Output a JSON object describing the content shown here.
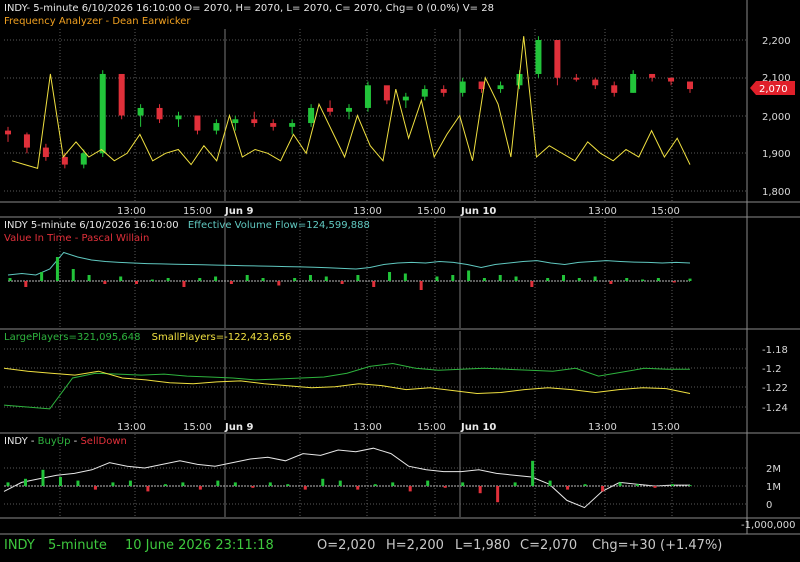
{
  "colors": {
    "background": "#000000",
    "grid": "#5a5a5a",
    "panel_border": "#8a8a8a",
    "axis_text": "#d8d8d8",
    "up": "#22c43a",
    "down": "#e0303a",
    "yellow": "#f0e040",
    "orange": "#f0a020",
    "cyan": "#60c8c0",
    "white": "#e8e8e8",
    "green_line": "#2eb43e",
    "status_green": "#3ec83e",
    "status_gray": "#c8c8c8",
    "last_price_bg": "#e0202a"
  },
  "panel1": {
    "header": "INDY- 5-minute 6/10/2026 16:10:00 O= 2070, H= 2070, L= 2070, C= 2070, Chg= 0 (0.0%) V= 28",
    "indicator": "Frequency Analyzer - Dean Earwicker",
    "last_price": "2,070",
    "y_ticks": [
      "2,200",
      "2,100",
      "2,000",
      "1,900",
      "1,800"
    ]
  },
  "time_axis": {
    "labels": [
      "13:00",
      "15:00",
      "Jun 9",
      "13:00",
      "15:00",
      "Jun 10",
      "13:00",
      "15:00"
    ]
  },
  "panel2": {
    "title_prefix": "INDY 5-minute  6/10/2026 16:10:00",
    "title_flow": "Effective Volume Flow=124,599,888",
    "subtitle": "Value In Time - Pascal Willain"
  },
  "panel3": {
    "large": "LargePlayers=321,095,648",
    "small": "SmallPlayers=-122,423,656",
    "y_ticks": [
      "-1.18",
      "-1.2",
      "-1.22",
      "-1.24"
    ]
  },
  "panel4": {
    "name": "INDY - ",
    "buy": "BuyUp",
    "sep": "-",
    "sell": "SellDown",
    "y_ticks": [
      "2M",
      "1M",
      "0",
      "-1,000,000"
    ]
  },
  "status": {
    "symbol": "INDY",
    "interval": "5-minute",
    "datetime": "10 June 2026 23:11:18",
    "o": "O=2,020",
    "h": "H=2,200",
    "l": "L=1,980",
    "c": "C=2,070",
    "chg": "Chg=+30 (+1.47%)"
  },
  "chart_data": [
    {
      "type": "candlestick",
      "title": "INDY- 5-minute",
      "series": [
        {
          "name": "INDY",
          "ohlc_approx": [
            [
              1960,
              1970,
              1930,
              1950
            ],
            [
              1950,
              1955,
              1900,
              1915
            ],
            [
              1915,
              1925,
              1880,
              1890
            ],
            [
              1890,
              1900,
              1860,
              1870
            ],
            [
              1870,
              1910,
              1860,
              1900
            ],
            [
              1900,
              2120,
              1890,
              2110
            ],
            [
              2110,
              2100,
              1990,
              2000
            ],
            [
              2000,
              2030,
              1970,
              2020
            ],
            [
              2020,
              2030,
              1980,
              1990
            ],
            [
              1990,
              2010,
              1970,
              2000
            ],
            [
              2000,
              1990,
              1950,
              1960
            ],
            [
              1960,
              1990,
              1950,
              1980
            ],
            [
              1980,
              2000,
              1960,
              1990
            ],
            [
              1990,
              2010,
              1970,
              1980
            ],
            [
              1980,
              1990,
              1960,
              1970
            ],
            [
              1970,
              1990,
              1950,
              1980
            ],
            [
              1980,
              2030,
              1970,
              2020
            ],
            [
              2020,
              2040,
              2000,
              2010
            ],
            [
              2010,
              2030,
              1990,
              2020
            ],
            [
              2020,
              2090,
              2010,
              2080
            ],
            [
              2080,
              2070,
              2030,
              2040
            ],
            [
              2040,
              2060,
              2020,
              2050
            ],
            [
              2050,
              2080,
              2040,
              2070
            ],
            [
              2070,
              2080,
              2050,
              2060
            ],
            [
              2060,
              2100,
              2050,
              2090
            ],
            [
              2090,
              2090,
              2060,
              2070
            ],
            [
              2070,
              2090,
              2060,
              2080
            ],
            [
              2080,
              2120,
              2070,
              2110
            ],
            [
              2110,
              2210,
              2100,
              2200
            ],
            [
              2200,
              2110,
              2080,
              2100
            ],
            [
              2100,
              2110,
              2090,
              2095
            ],
            [
              2095,
              2100,
              2070,
              2080
            ],
            [
              2080,
              2090,
              2050,
              2060
            ],
            [
              2060,
              2120,
              2060,
              2110
            ],
            [
              2110,
              2110,
              2090,
              2100
            ],
            [
              2100,
              2100,
              2080,
              2090
            ],
            [
              2090,
              2080,
              2060,
              2070
            ]
          ]
        },
        {
          "name": "Frequency Analyzer - Dean Earwicker",
          "values_approx": [
            1880,
            1870,
            1860,
            2110,
            1890,
            1930,
            1890,
            1910,
            1880,
            1900,
            1950,
            1880,
            1900,
            1910,
            1870,
            1920,
            1880,
            2000,
            1890,
            1910,
            1900,
            1880,
            1950,
            1900,
            2030,
            1960,
            1890,
            2000,
            1920,
            1880,
            2070,
            1940,
            2040,
            1890,
            1950,
            2000,
            1880,
            2100,
            2030,
            1890,
            2210,
            1890,
            1920,
            1900,
            1880,
            1930,
            1900,
            1880,
            1910,
            1890,
            1960,
            1890,
            1940,
            1870
          ]
        }
      ],
      "ylim": [
        1760,
        2230
      ],
      "y_ticks": [
        1800,
        1900,
        2000,
        2100,
        2200
      ]
    },
    {
      "type": "bar",
      "title": "Effective Volume Flow=124,599,888",
      "series": [
        {
          "name": "Effective Volume Flow",
          "values_approx": [
            0.2,
            0.25,
            0.2,
            0.4,
            0.95,
            0.8,
            0.7,
            0.65,
            0.62,
            0.6,
            0.58,
            0.57,
            0.56,
            0.55,
            0.54,
            0.53,
            0.52,
            0.51,
            0.5,
            0.49,
            0.48,
            0.47,
            0.46,
            0.44,
            0.42,
            0.4,
            0.45,
            0.55,
            0.6,
            0.62,
            0.6,
            0.65,
            0.62,
            0.55,
            0.45,
            0.55,
            0.6,
            0.65,
            0.68,
            0.6,
            0.55,
            0.62,
            0.65,
            0.68,
            0.65,
            0.63,
            0.62,
            0.6,
            0.62,
            0.6
          ]
        },
        {
          "name": "Value In Time",
          "values_approx": [
            0.1,
            -0.2,
            0.3,
            0.8,
            0.4,
            0.2,
            -0.1,
            0.15,
            -0.1,
            0.05,
            0.1,
            -0.2,
            0.1,
            0.15,
            -0.1,
            0.2,
            0.1,
            -0.15,
            0.1,
            0.2,
            0.15,
            -0.1,
            0.2,
            -0.2,
            0.3,
            0.25,
            -0.3,
            0.15,
            0.2,
            0.35,
            0.1,
            0.2,
            0.15,
            -0.2,
            0.1,
            0.2,
            0.1,
            0.15,
            -0.1,
            0.1,
            0.05,
            0.1,
            -0.05,
            0.08
          ]
        }
      ]
    },
    {
      "type": "line",
      "title": "LargePlayers / SmallPlayers",
      "series": [
        {
          "name": "LargePlayers=321,095,648",
          "values_approx": [
            -1.238,
            -1.24,
            -1.242,
            -1.21,
            -1.205,
            -1.206,
            -1.207,
            -1.206,
            -1.208,
            -1.209,
            -1.21,
            -1.212,
            -1.211,
            -1.21,
            -1.209,
            -1.205,
            -1.198,
            -1.195,
            -1.2,
            -1.202,
            -1.201,
            -1.2,
            -1.201,
            -1.202,
            -1.203,
            -1.2,
            -1.208,
            -1.204,
            -1.2,
            -1.201,
            -1.201
          ]
        },
        {
          "name": "SmallPlayers=-122,423,656",
          "values_approx": [
            -1.2,
            -1.203,
            -1.205,
            -1.207,
            -1.203,
            -1.21,
            -1.212,
            -1.215,
            -1.216,
            -1.214,
            -1.213,
            -1.216,
            -1.218,
            -1.22,
            -1.219,
            -1.216,
            -1.218,
            -1.222,
            -1.22,
            -1.223,
            -1.226,
            -1.225,
            -1.222,
            -1.22,
            -1.222,
            -1.225,
            -1.222,
            -1.22,
            -1.221,
            -1.226
          ]
        }
      ],
      "y_ticks": [
        -1.18,
        -1.2,
        -1.22,
        -1.24
      ],
      "ylim": [
        -1.25,
        -1.17
      ]
    },
    {
      "type": "bar",
      "title": "INDY - BuyUp-SellDown",
      "series": [
        {
          "name": "BuyUp-SellDown line",
          "values_approx": [
            -0.3,
            0.2,
            0.4,
            0.6,
            0.7,
            0.9,
            1.3,
            1.1,
            1.0,
            1.2,
            1.4,
            1.2,
            1.1,
            1.3,
            1.5,
            1.6,
            1.4,
            1.8,
            1.7,
            2.0,
            1.9,
            2.1,
            1.8,
            1.1,
            0.9,
            0.8,
            0.8,
            0.9,
            0.7,
            0.6,
            0.5,
            0.1,
            -0.8,
            -1.2,
            -0.3,
            0.2,
            0.1,
            0.0,
            0.05,
            0.05
          ]
        },
        {
          "name": "BuyUp-SellDown bars",
          "values_approx": [
            0.2,
            0.4,
            0.9,
            0.5,
            0.3,
            -0.2,
            0.2,
            0.3,
            -0.3,
            0.1,
            0.2,
            -0.2,
            0.3,
            0.2,
            -0.1,
            0.2,
            0.1,
            -0.2,
            0.4,
            0.3,
            -0.2,
            0.1,
            0.2,
            -0.3,
            0.3,
            -0.1,
            0.2,
            -0.4,
            -0.9,
            0.2,
            1.4,
            0.3,
            -0.2,
            0.1,
            -0.3,
            0.2,
            0.1,
            -0.1,
            0.1,
            0.05
          ]
        }
      ],
      "y_ticks": [
        2000000,
        1000000,
        0,
        -1000000
      ],
      "ylim": [
        -1300000,
        2300000
      ]
    }
  ]
}
